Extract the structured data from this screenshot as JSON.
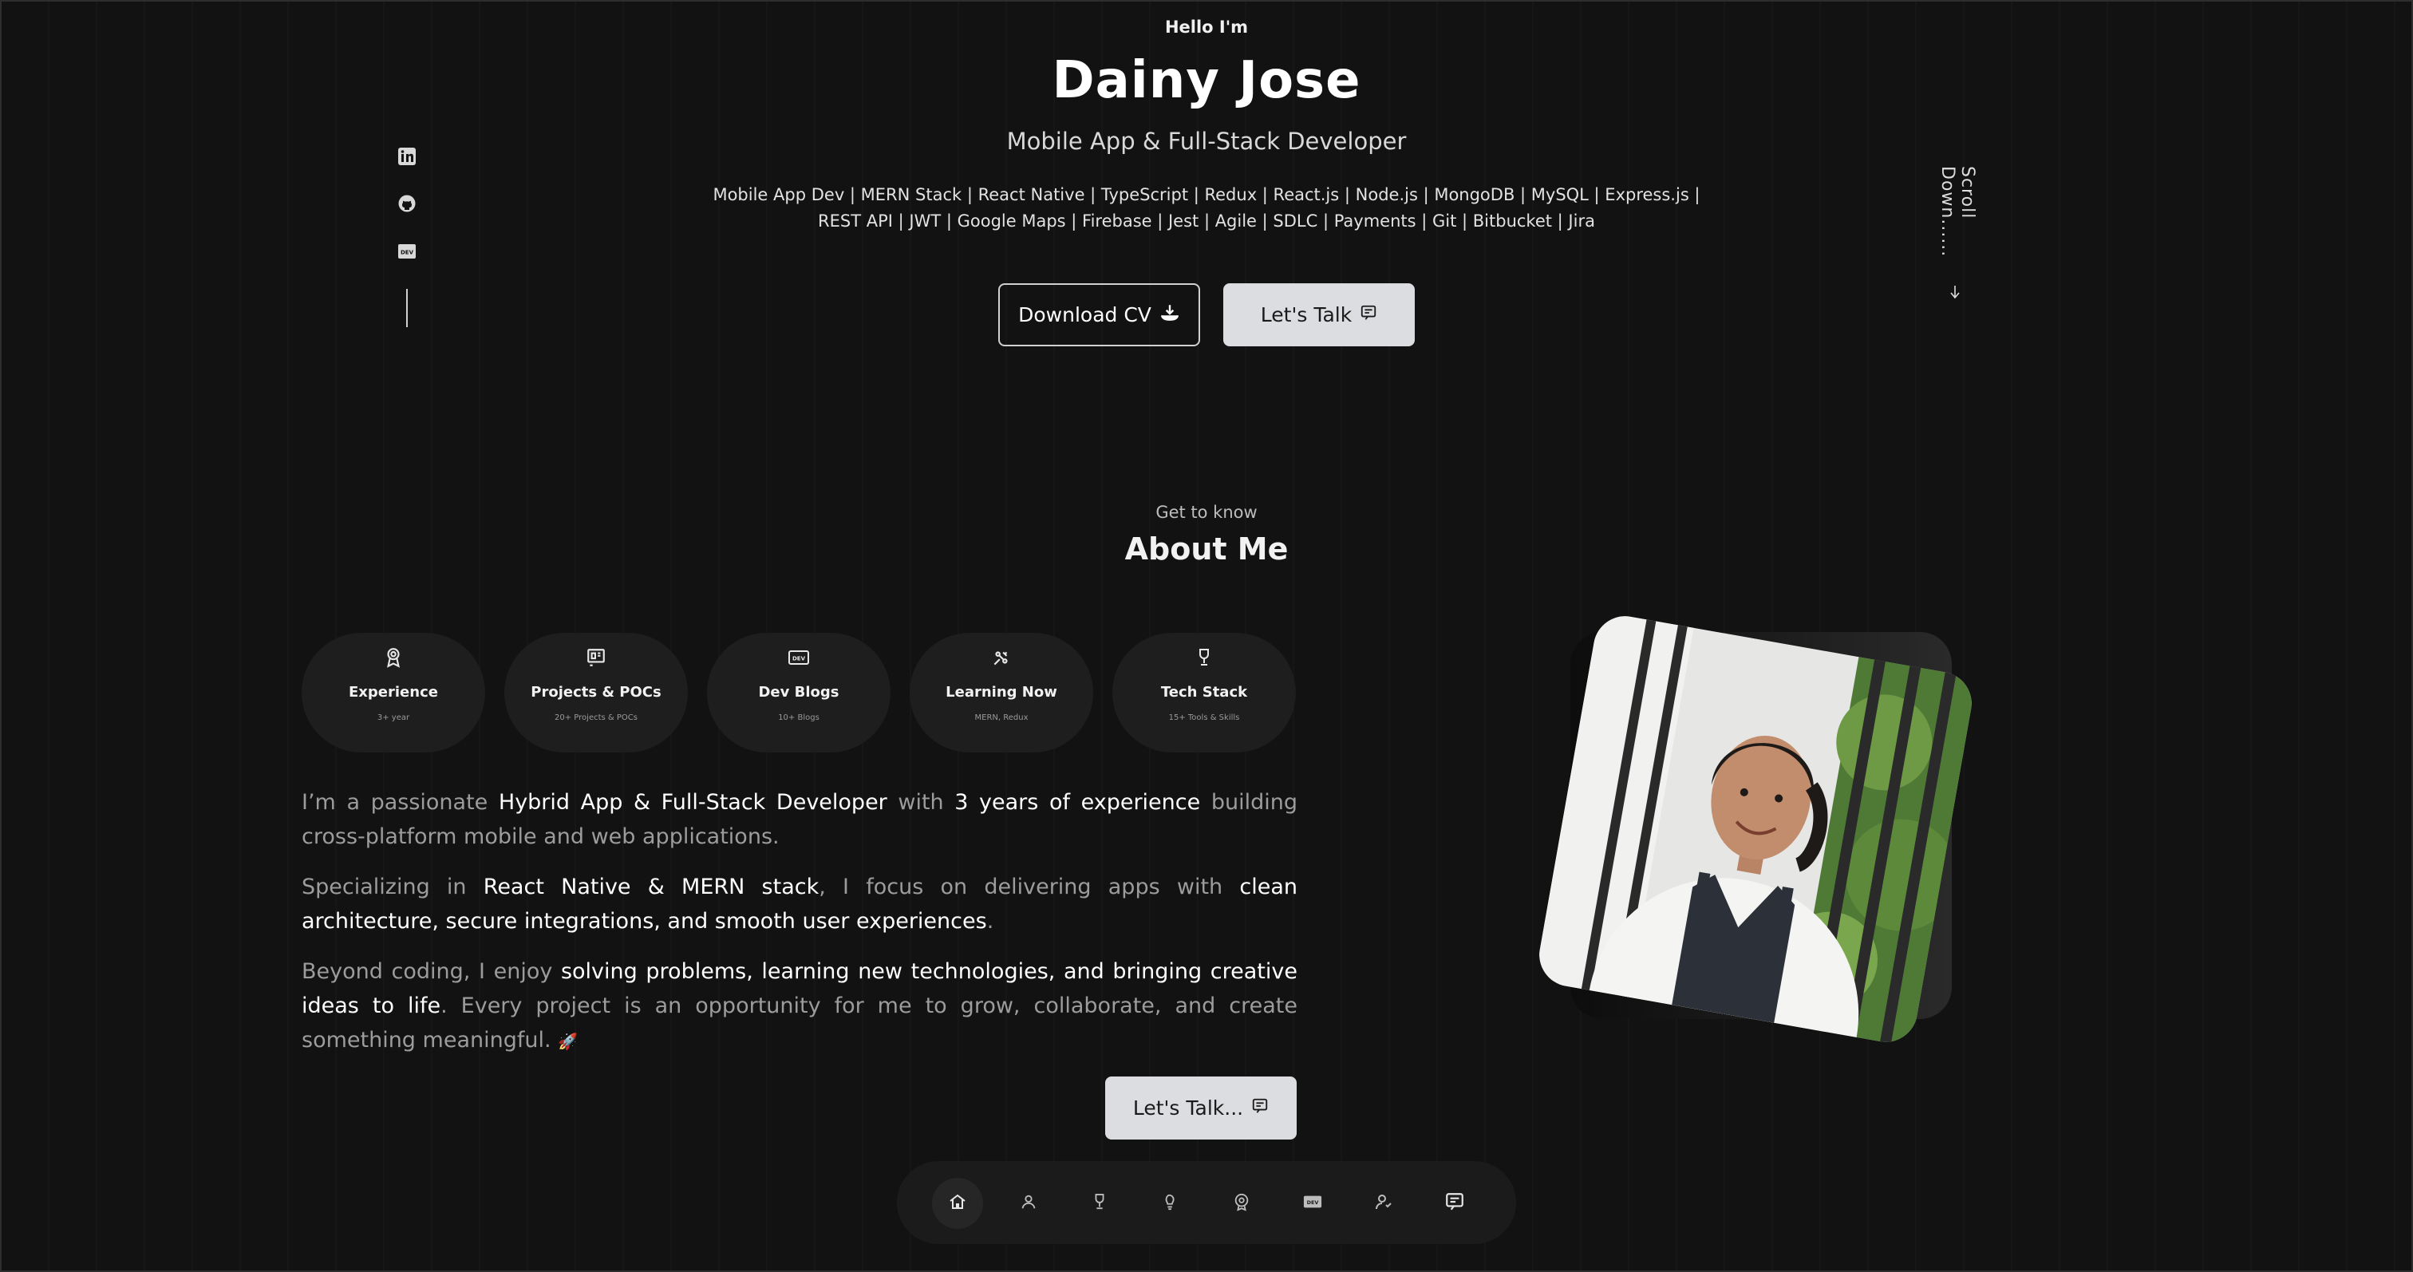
{
  "hero": {
    "greeting": "Hello I'm",
    "name": "Dainy Jose",
    "role": "Mobile App & Full-Stack Developer",
    "skills_line1": "Mobile App Dev | MERN Stack | React Native | TypeScript | Redux | React.js | Node.js | MongoDB | MySQL | Express.js |",
    "skills_line2": "REST API | JWT | Google Maps | Firebase | Jest | Agile | SDLC | Payments | Git | Bitbucket | Jira",
    "download_cv": "Download CV",
    "lets_talk": "Let's Talk",
    "scroll_down": "Scroll Down......"
  },
  "socials": [
    {
      "icon": "linkedin-icon"
    },
    {
      "icon": "github-icon"
    },
    {
      "icon": "dev-icon"
    }
  ],
  "about": {
    "subtitle": "Get to know",
    "title": "About Me",
    "cards": [
      {
        "title": "Experience",
        "sub": "3+ year",
        "icon": "award-icon"
      },
      {
        "title": "Projects & POCs",
        "sub": "20+ Projects & POCs",
        "icon": "projects-icon"
      },
      {
        "title": "Dev Blogs",
        "sub": "10+ Blogs",
        "icon": "dev-icon"
      },
      {
        "title": "Learning Now",
        "sub": "MERN, Redux",
        "icon": "learning-icon"
      },
      {
        "title": "Tech Stack",
        "sub": "15+ Tools & Skills",
        "icon": "trophy-icon"
      }
    ],
    "bio": {
      "p1_a": "I’m a passionate ",
      "p1_b": "Hybrid App & Full-Stack Developer",
      "p1_c": " with ",
      "p1_d": "3 years of experience",
      "p1_e": " building cross-platform mobile and web applications.",
      "p2_a": "Specializing in ",
      "p2_b": "React Native & MERN stack",
      "p2_c": ", I focus on delivering apps with ",
      "p2_d": "clean architecture, secure integrations, and smooth user experiences",
      "p2_e": ".",
      "p3_a": "Beyond coding, I enjoy ",
      "p3_b": "solving problems, learning new technologies, and bringing creative ideas to life",
      "p3_c": ". Every project is an opportunity for me to grow, collaborate, and create something meaningful.",
      "p3_emoji": "🚀"
    },
    "lets_talk": "Let's Talk..."
  },
  "nav": [
    {
      "icon": "home-icon",
      "active": true
    },
    {
      "icon": "user-icon"
    },
    {
      "icon": "trophy-icon"
    },
    {
      "icon": "learning-icon"
    },
    {
      "icon": "award-icon"
    },
    {
      "icon": "dev-icon"
    },
    {
      "icon": "contact-user-icon"
    },
    {
      "icon": "message-icon"
    }
  ],
  "colors": {
    "background": "#121212",
    "card": "#1e1e1e",
    "button_light": "#dcdde0",
    "text_muted": "#9c9c9c"
  }
}
